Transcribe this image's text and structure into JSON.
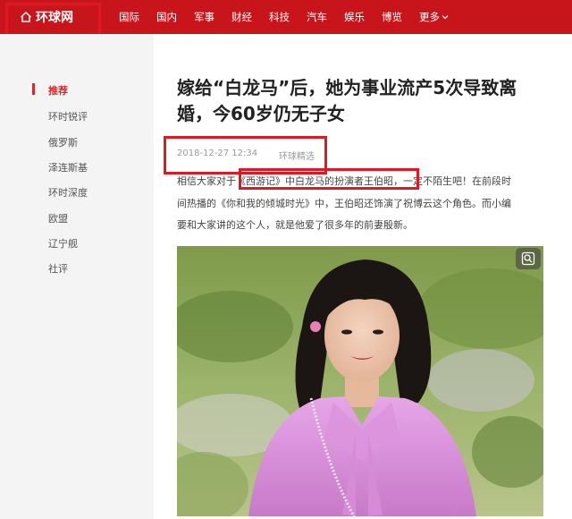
{
  "header": {
    "logo_text": "环球网",
    "nav": [
      "国际",
      "国内",
      "军事",
      "财经",
      "科技",
      "汽车",
      "娱乐",
      "博览"
    ],
    "more_label": "更多"
  },
  "sidebar": {
    "items": [
      {
        "label": "推荐",
        "active": true
      },
      {
        "label": "环时锐评"
      },
      {
        "label": "俄罗斯"
      },
      {
        "label": "泽连斯基"
      },
      {
        "label": "环时深度"
      },
      {
        "label": "欧盟"
      },
      {
        "label": "辽宁舰"
      },
      {
        "label": "社评"
      }
    ]
  },
  "article": {
    "title_line1": "嫁给“白龙马”后，她为事业流产5次导致离",
    "title_line2": "婚，今60岁仍无子女",
    "date": "2018-12-27 12:34",
    "source": "环球精选",
    "para_line1": "相信大家对于《西游记》中白龙马的扮演者王伯昭，一定不陌生吧！在前段时",
    "para_line2": "间热播的《你和我的倾城时光》中，王伯昭还饰演了祝博云这个角色。而小编",
    "para_line3": "要和大家讲的这个人，就是他爱了很多年的前妻殷新。"
  },
  "colors": {
    "brand_red": "#c8141b",
    "highlight_red": "#e01822",
    "sidebar_bg": "#f4f4f4"
  }
}
